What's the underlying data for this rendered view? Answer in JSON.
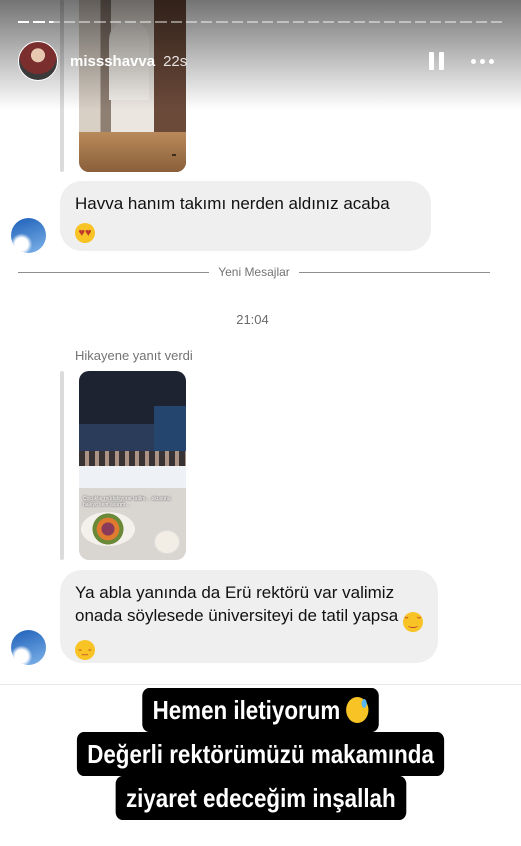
{
  "story": {
    "username": "missshavva",
    "time_ago": "22s",
    "progress_segments": [
      "done",
      "done",
      "active",
      "todo",
      "todo",
      "todo",
      "todo",
      "todo",
      "todo",
      "todo",
      "todo",
      "todo",
      "todo",
      "todo",
      "todo",
      "todo",
      "todo",
      "todo",
      "todo",
      "todo",
      "todo",
      "todo",
      "todo",
      "todo",
      "todo",
      "todo",
      "todo",
      "todo",
      "todo",
      "todo",
      "todo",
      "todo"
    ],
    "pause_icon": "pause-icon",
    "more_icon": "more-options-icon"
  },
  "thread": {
    "message1": {
      "text": "Havva hanım takımı nerden aldınız acaba",
      "emoji": "heart-eyes-emoji"
    },
    "new_messages_label": "Yeni Mesajlar",
    "timestamp": "21:04",
    "replied_label": "Hikayene yanıt verdi",
    "thumb2_caption": "Çocuklar müdahiyorar tatilm… okusunu haleyo sent avarım…",
    "message2": {
      "text": "Ya abla yanında da Erü rektörü var valimiz onada söylesede üniversiteyi de tatil yapsa",
      "emojis": [
        "tears-of-joy-emoji",
        "sleepy-face-emoji"
      ]
    }
  },
  "overlay": {
    "line1": "Hemen iletiyorum",
    "line1_emoji": "grinning-sweat-emoji",
    "line2": "Değerli rektörümüzü makamında",
    "line3": "ziyaret edeceğim inşallah"
  }
}
